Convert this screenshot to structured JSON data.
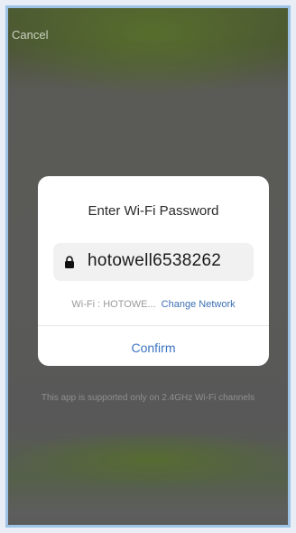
{
  "header": {
    "cancel_label": "Cancel"
  },
  "dialog": {
    "title": "Enter Wi-Fi Password",
    "password_value": "hotowell6538262",
    "wifi_label": "Wi-Fi : HOTOWE...",
    "change_network_label": "Change Network",
    "confirm_label": "Confirm"
  },
  "info_text": "This app is supported only on 2.4GHz Wi-Fi channels",
  "icons": {
    "lock": "lock-icon"
  },
  "colors": {
    "accent": "#3b74c2",
    "overlay": "#5a5a5a",
    "dialog": "#ffffff"
  }
}
